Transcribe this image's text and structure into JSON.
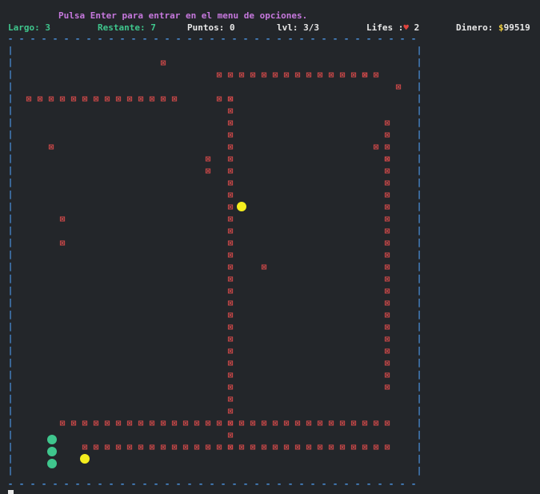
{
  "header": {
    "hint": "Pulsa Enter para entrar en el menu de opciones.",
    "largo_label": "Largo:",
    "largo_value": "3",
    "restante_label": "Restante:",
    "restante_value": "7",
    "puntos_label": "Puntos:",
    "puntos_value": "0",
    "lvl_label": "lvl:",
    "lvl_value": "3/3",
    "lifes_label": "Lifes :",
    "lifes_heart": "♥",
    "lifes_value": "2",
    "dinero_label": "Dinero:",
    "dinero_symbol": "$",
    "dinero_value": "99519"
  },
  "board": {
    "cols": 36,
    "rows": 30,
    "wall_glyph": "⊠",
    "border_vertical_glyph": "|",
    "border_horizontal_glyph": "-",
    "obstacles": [
      [
        1,
        13
      ],
      [
        18,
        22
      ],
      [
        2,
        31
      ],
      [
        3,
        34
      ],
      [
        8,
        3
      ],
      [
        14,
        4
      ],
      [
        16,
        4
      ],
      [
        9,
        17
      ],
      [
        10,
        17
      ],
      [
        4,
        18
      ],
      [
        4,
        19
      ],
      [
        8,
        32
      ],
      [
        9,
        33
      ],
      [
        4,
        1
      ],
      [
        4,
        2
      ],
      [
        4,
        3
      ],
      [
        4,
        4
      ],
      [
        4,
        5
      ],
      [
        4,
        6
      ],
      [
        4,
        7
      ],
      [
        4,
        8
      ],
      [
        4,
        9
      ],
      [
        4,
        10
      ],
      [
        4,
        11
      ],
      [
        4,
        12
      ],
      [
        4,
        13
      ],
      [
        4,
        14
      ],
      [
        2,
        18
      ],
      [
        2,
        19
      ],
      [
        2,
        20
      ],
      [
        2,
        21
      ],
      [
        2,
        22
      ],
      [
        2,
        23
      ],
      [
        2,
        24
      ],
      [
        2,
        25
      ],
      [
        2,
        26
      ],
      [
        2,
        27
      ],
      [
        2,
        28
      ],
      [
        2,
        29
      ],
      [
        2,
        30
      ],
      [
        2,
        31
      ],
      [
        2,
        32
      ],
      [
        4,
        19
      ],
      [
        5,
        19
      ],
      [
        6,
        19
      ],
      [
        7,
        19
      ],
      [
        8,
        19
      ],
      [
        9,
        19
      ],
      [
        10,
        19
      ],
      [
        11,
        19
      ],
      [
        12,
        19
      ],
      [
        13,
        19
      ],
      [
        14,
        19
      ],
      [
        15,
        19
      ],
      [
        16,
        19
      ],
      [
        17,
        19
      ],
      [
        18,
        19
      ],
      [
        19,
        19
      ],
      [
        20,
        19
      ],
      [
        21,
        19
      ],
      [
        22,
        19
      ],
      [
        23,
        19
      ],
      [
        24,
        19
      ],
      [
        25,
        19
      ],
      [
        26,
        19
      ],
      [
        27,
        19
      ],
      [
        28,
        19
      ],
      [
        29,
        19
      ],
      [
        30,
        19
      ],
      [
        31,
        19
      ],
      [
        32,
        19
      ],
      [
        33,
        19
      ],
      [
        6,
        33
      ],
      [
        7,
        33
      ],
      [
        8,
        33
      ],
      [
        9,
        33
      ],
      [
        10,
        33
      ],
      [
        11,
        33
      ],
      [
        12,
        33
      ],
      [
        13,
        33
      ],
      [
        14,
        33
      ],
      [
        15,
        33
      ],
      [
        16,
        33
      ],
      [
        17,
        33
      ],
      [
        18,
        33
      ],
      [
        19,
        33
      ],
      [
        20,
        33
      ],
      [
        21,
        33
      ],
      [
        22,
        33
      ],
      [
        23,
        33
      ],
      [
        24,
        33
      ],
      [
        25,
        33
      ],
      [
        26,
        33
      ],
      [
        27,
        33
      ],
      [
        28,
        33
      ],
      [
        31,
        4
      ],
      [
        31,
        5
      ],
      [
        31,
        6
      ],
      [
        31,
        7
      ],
      [
        31,
        8
      ],
      [
        31,
        9
      ],
      [
        31,
        10
      ],
      [
        31,
        11
      ],
      [
        31,
        12
      ],
      [
        31,
        13
      ],
      [
        31,
        14
      ],
      [
        31,
        15
      ],
      [
        31,
        16
      ],
      [
        31,
        17
      ],
      [
        31,
        18
      ],
      [
        31,
        19
      ],
      [
        31,
        20
      ],
      [
        31,
        21
      ],
      [
        31,
        22
      ],
      [
        31,
        23
      ],
      [
        31,
        24
      ],
      [
        31,
        25
      ],
      [
        31,
        26
      ],
      [
        31,
        27
      ],
      [
        31,
        28
      ],
      [
        31,
        29
      ],
      [
        31,
        30
      ],
      [
        31,
        31
      ],
      [
        31,
        32
      ],
      [
        31,
        33
      ],
      [
        33,
        6
      ],
      [
        33,
        7
      ],
      [
        33,
        8
      ],
      [
        33,
        9
      ],
      [
        33,
        10
      ],
      [
        33,
        11
      ],
      [
        33,
        12
      ],
      [
        33,
        13
      ],
      [
        33,
        14
      ],
      [
        33,
        15
      ],
      [
        33,
        16
      ],
      [
        33,
        17
      ],
      [
        33,
        18
      ],
      [
        33,
        19
      ],
      [
        33,
        20
      ],
      [
        33,
        21
      ],
      [
        33,
        22
      ],
      [
        33,
        23
      ],
      [
        33,
        24
      ],
      [
        33,
        25
      ],
      [
        33,
        26
      ],
      [
        33,
        27
      ],
      [
        33,
        28
      ],
      [
        33,
        29
      ],
      [
        33,
        30
      ],
      [
        33,
        31
      ],
      [
        33,
        32
      ],
      [
        33,
        33
      ]
    ],
    "snake": [
      [
        32,
        3
      ],
      [
        33,
        3
      ],
      [
        34,
        3
      ]
    ],
    "food": [
      [
        13,
        20
      ],
      [
        34,
        6
      ]
    ],
    "colors": {
      "wall": "#d84b4b",
      "border": "#4a8fd8",
      "snake": "#3fc68d",
      "food": "#f5ee1e"
    }
  }
}
